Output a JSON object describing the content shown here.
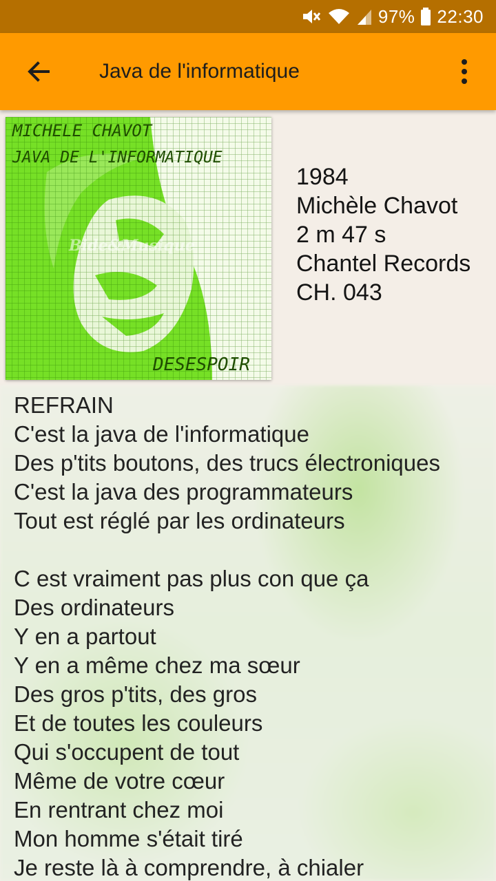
{
  "status_bar": {
    "battery": "97%",
    "time": "22:30",
    "icons": [
      "mute-icon",
      "wifi-icon",
      "signal-icon",
      "battery-icon"
    ]
  },
  "app_bar": {
    "title": "Java de l'informatique",
    "back_icon": "arrow-left-icon",
    "menu_icon": "more-vert-icon",
    "color": "#ff9a00"
  },
  "cover": {
    "line1": "MICHELE CHAVOT",
    "line2": "JAVA DE L'INFORMATIQUE",
    "bottom": "DESESPOIR",
    "watermark": "Bide&Musique",
    "color": "#76e026"
  },
  "song_info": {
    "year": "1984",
    "artist": "Michèle Chavot",
    "duration": "2 m 47 s",
    "label": "Chantel Records",
    "reference": "CH. 043"
  },
  "lyrics": [
    "REFRAIN",
    "C'est la java de l'informatique",
    "Des p'tits boutons, des trucs électroniques",
    "C'est la java des programmateurs",
    "Tout est réglé par les ordinateurs",
    "",
    "C est vraiment pas plus con que ça",
    "Des ordinateurs",
    "Y en a partout",
    "Y en a même chez ma sœur",
    "Des gros p'tits, des gros",
    "Et de toutes les couleurs",
    "Qui s'occupent de tout",
    "Même de votre cœur",
    "En rentrant chez moi",
    "Mon homme s'était tiré",
    "Je reste là à comprendre, à chialer"
  ]
}
